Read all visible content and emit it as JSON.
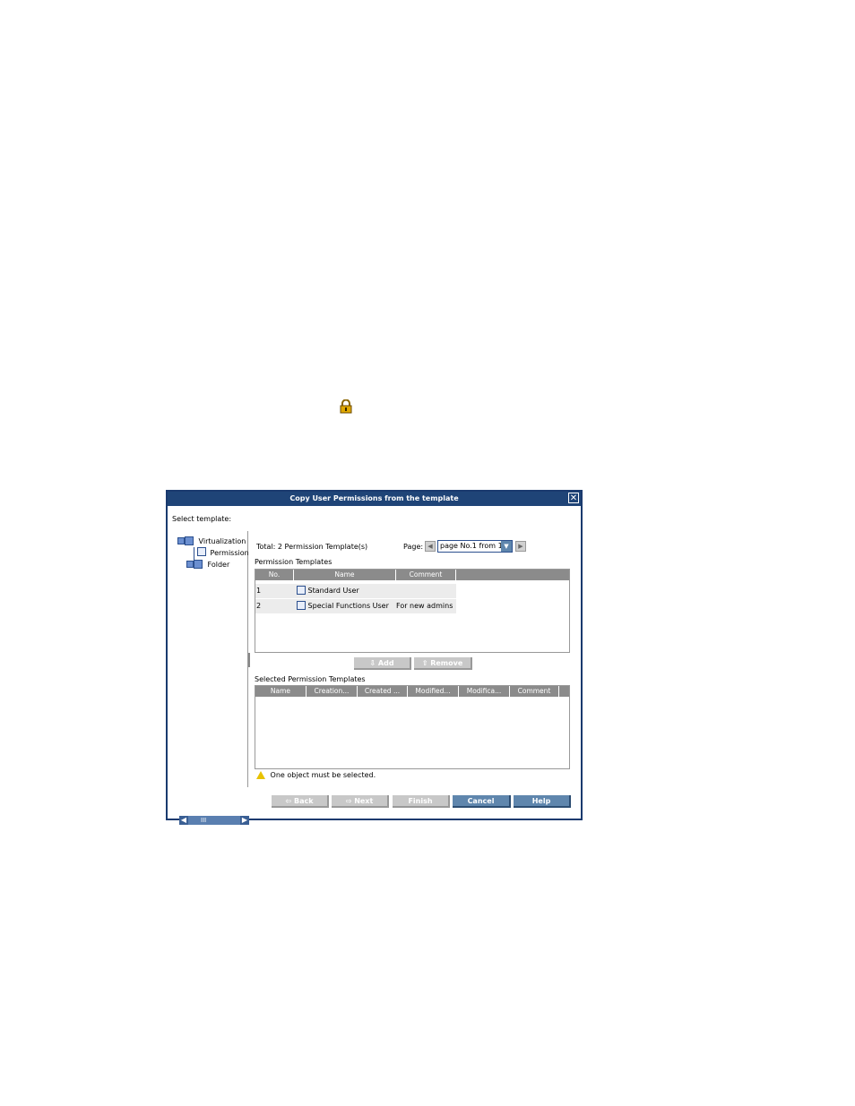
{
  "dialog": {
    "title": "Copy User Permissions from the template",
    "close_label": "✕",
    "select_template_label": "Select template:"
  },
  "tree": {
    "root": "Virtualization",
    "child1": "Permission",
    "child2": "Folder",
    "hscroll_thumb": "III"
  },
  "summary": {
    "total": "Total: 2 Permission Template(s)",
    "page_label": "Page:",
    "page_value": "page No.1 from 1"
  },
  "permission_templates": {
    "label": "Permission Templates",
    "columns": [
      "No.",
      "Name",
      "Comment"
    ],
    "rows": [
      {
        "no": "1",
        "name": "Standard User",
        "comment": ""
      },
      {
        "no": "2",
        "name": "Special Functions User",
        "comment": "For new admins"
      }
    ]
  },
  "actions": {
    "add": "Add",
    "remove": "Remove"
  },
  "selected_templates": {
    "label": "Selected Permission Templates",
    "columns": [
      "Name",
      "Creation...",
      "Created ...",
      "Modified...",
      "Modifica...",
      "Comment"
    ]
  },
  "status": {
    "message": "One object must be selected."
  },
  "footer": {
    "back": "Back",
    "next": "Next",
    "finish": "Finish",
    "cancel": "Cancel",
    "help": "Help"
  },
  "colors": {
    "titlebar": "#1f4477",
    "active_button": "#5f86ad",
    "disabled_button": "#c8c8c8",
    "header_gray": "#8b8b8b"
  }
}
